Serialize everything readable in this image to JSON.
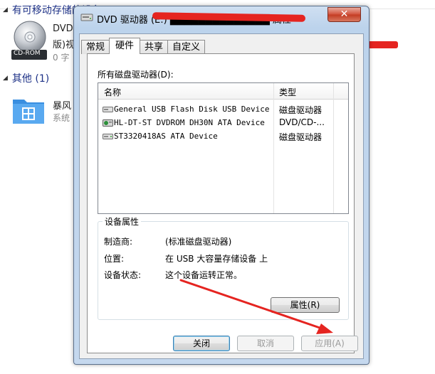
{
  "background": {
    "group1_title": "有可移动存储的设备 (",
    "drive_label": "DVD",
    "drive_sub": "版)视",
    "drive_free": "0 字",
    "cdrom_text": "CD-ROM",
    "group2_title": "其他 (1)",
    "other_name": "暴风",
    "other_sub": "系统"
  },
  "dialog": {
    "title": "DVD 驱动器 (E:) ██████████████ 属性",
    "close_glyph": "✕",
    "tabs": [
      "常规",
      "硬件",
      "共享",
      "自定义"
    ],
    "active_tab": "硬件",
    "list_label": "所有磁盘驱动器(D):",
    "columns": [
      "名称",
      "类型"
    ],
    "devices": [
      {
        "name": "General USB Flash Disk USB Device",
        "type": "磁盘驱动器",
        "icon": "usb-drive-icon"
      },
      {
        "name": "HL-DT-ST DVDROM DH30N ATA Device",
        "type": "DVD/CD-...",
        "icon": "dvd-drive-icon"
      },
      {
        "name": "ST3320418AS ATA Device",
        "type": "磁盘驱动器",
        "icon": "hard-disk-icon"
      }
    ],
    "properties_group_title": "设备属性",
    "manufacturer_label": "制造商:",
    "manufacturer_value": "(标准磁盘驱动器)",
    "location_label": "位置:",
    "location_value": "在 USB 大容量存储设备 上",
    "status_label": "设备状态:",
    "status_value": "这个设备运转正常。",
    "properties_button": "属性(R)",
    "close_button": "关闭",
    "cancel_button": "取消",
    "apply_button": "应用(A)"
  },
  "colors": {
    "annotation_red": "#e52420",
    "header_blue": "#1e3287"
  }
}
